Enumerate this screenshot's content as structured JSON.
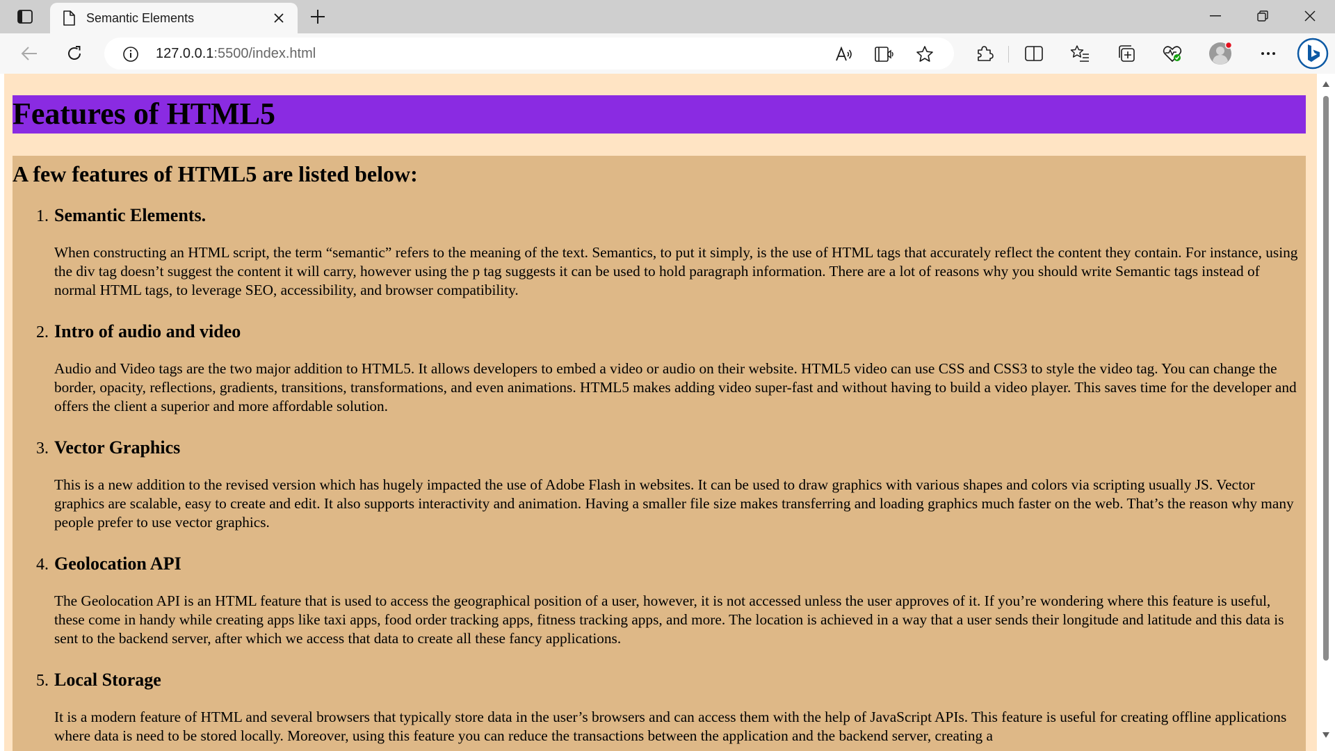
{
  "window": {
    "tab_title": "Semantic Elements",
    "url_host": "127.0.0.1",
    "url_path": ":5500/index.html",
    "colors": {
      "tabbar": "#cfcfcf",
      "toolbar": "#f7f7f7",
      "accent": "#0c59a4"
    }
  },
  "page": {
    "header_title": "Features of HTML5",
    "intro_heading": "A few features of HTML5 are listed below:",
    "colors": {
      "body_bg": "#ffe4c4",
      "header_bg": "#8a2be2",
      "main_bg": "#deb887"
    },
    "features": [
      {
        "number": "1.",
        "title": "Semantic Elements.",
        "text": "When constructing an HTML script, the term “semantic” refers to the meaning of the text. Semantics, to put it simply, is the use of HTML tags that accurately reflect the content they contain. For instance, using the div tag doesn’t suggest the content it will carry, however using the p tag suggests it can be used to hold paragraph information. There are a lot of reasons why you should write Semantic tags instead of normal HTML tags, to leverage SEO, accessibility, and browser compatibility."
      },
      {
        "number": "2.",
        "title": "Intro of audio and video",
        "text": "Audio and Video tags are the two major addition to HTML5. It allows developers to embed a video or audio on their website. HTML5 video can use CSS and CSS3 to style the video tag. You can change the border, opacity, reflections, gradients, transitions, transformations, and even animations. HTML5 makes adding video super-fast and without having to build a video player. This saves time for the developer and offers the client a superior and more affordable solution."
      },
      {
        "number": "3.",
        "title": "Vector Graphics",
        "text": "This is a new addition to the revised version which has hugely impacted the use of Adobe Flash in websites. It can be used to draw graphics with various shapes and colors via scripting usually JS. Vector graphics are scalable, easy to create and edit. It also supports interactivity and animation. Having a smaller file size makes transferring and loading graphics much faster on the web. That’s the reason why many people prefer to use vector graphics."
      },
      {
        "number": "4.",
        "title": "Geolocation API",
        "text": "The Geolocation API is an HTML feature that is used to access the geographical position of a user, however, it is not accessed unless the user approves of it. If you’re wondering where this feature is useful, these come in handy while creating apps like taxi apps, food order tracking apps, fitness tracking apps, and more. The location is achieved in a way that a user sends their longitude and latitude and this data is sent to the backend server, after which we access that data to create all these fancy applications."
      },
      {
        "number": "5.",
        "title": "Local Storage",
        "text": "It is a modern feature of HTML and several browsers that typically store data in the user’s browsers and can access them with the help of JavaScript APIs. This feature is useful for creating offline applications where data is need to be stored locally. Moreover, using this feature you can reduce the transactions between the application and the backend server, creating a"
      }
    ]
  }
}
